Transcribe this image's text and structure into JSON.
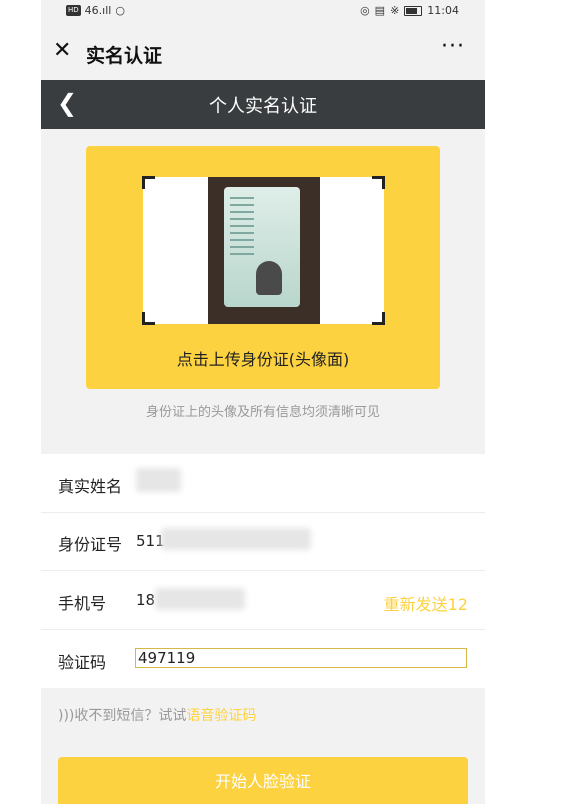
{
  "status_bar": {
    "network_badge": "HD",
    "signal_text": "46.ıll",
    "time": "11:04"
  },
  "title_bar": {
    "close_icon": "close-icon",
    "title": "实名认证",
    "more_label": "···"
  },
  "header": {
    "back_icon": "chevron-left-icon",
    "title": "个人实名认证"
  },
  "upload": {
    "label": "点击上传身份证(头像面)",
    "hint": "身份证上的头像及所有信息均须清晰可见"
  },
  "form": {
    "name_label": "真实姓名",
    "name_value": "",
    "id_label": "身份证号",
    "id_value": "511",
    "phone_label": "手机号",
    "phone_value": "18",
    "resend_label": "重新发送12",
    "code_label": "验证码",
    "code_value": "497119"
  },
  "sms_help": {
    "prefix": "收不到短信？试试",
    "link": "语音验证码"
  },
  "start_button": "开始人脸验证",
  "colors": {
    "accent": "#fdd241",
    "dark_header": "#3a3d40",
    "background": "#f2f2f2"
  }
}
